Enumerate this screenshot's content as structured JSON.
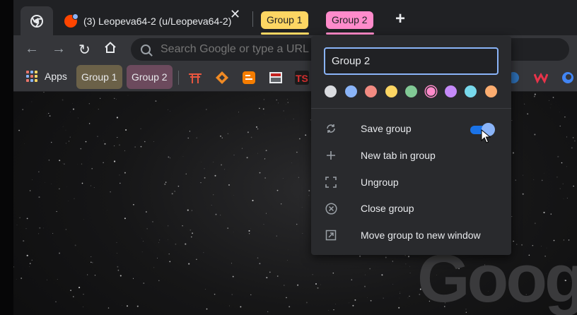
{
  "tabs": {
    "reddit_title": "(3) Leopeva64-2 (u/Leopeva64-2)",
    "group_chips": [
      "Group 1",
      "Group 2"
    ],
    "group_colors": [
      "#fdd663",
      "#ff8bcb"
    ]
  },
  "toolbar": {
    "omnibox_placeholder": "Search Google or type a URL"
  },
  "bookmarks": {
    "apps_label": "Apps",
    "group_1": "Group 1",
    "group_2": "Group 2",
    "icons": [
      "torii-icon",
      "diamond-icon",
      "blogger-icon",
      "book-icon",
      "ts-icon"
    ]
  },
  "group_editor": {
    "name_value": "Group 2",
    "colors": [
      {
        "name": "grey",
        "hex": "#dadce0"
      },
      {
        "name": "blue",
        "hex": "#8ab4f8"
      },
      {
        "name": "red",
        "hex": "#f28b82"
      },
      {
        "name": "yellow",
        "hex": "#fdd663"
      },
      {
        "name": "green",
        "hex": "#81c995"
      },
      {
        "name": "pink",
        "hex": "#ff8bcb",
        "selected": true
      },
      {
        "name": "purple",
        "hex": "#c58af9"
      },
      {
        "name": "cyan",
        "hex": "#78d9ec"
      },
      {
        "name": "orange",
        "hex": "#fcad70"
      }
    ],
    "menu": [
      {
        "label": "Save group",
        "icon": "sync-icon"
      },
      {
        "label": "New tab in group",
        "icon": "plus-icon"
      },
      {
        "label": "Ungroup",
        "icon": "ungroup-icon"
      },
      {
        "label": "Close group",
        "icon": "close-circle-icon"
      },
      {
        "label": "Move group to new window",
        "icon": "open-window-icon"
      }
    ],
    "save_group_enabled": true
  },
  "page": {
    "logo_text": "Goog"
  }
}
